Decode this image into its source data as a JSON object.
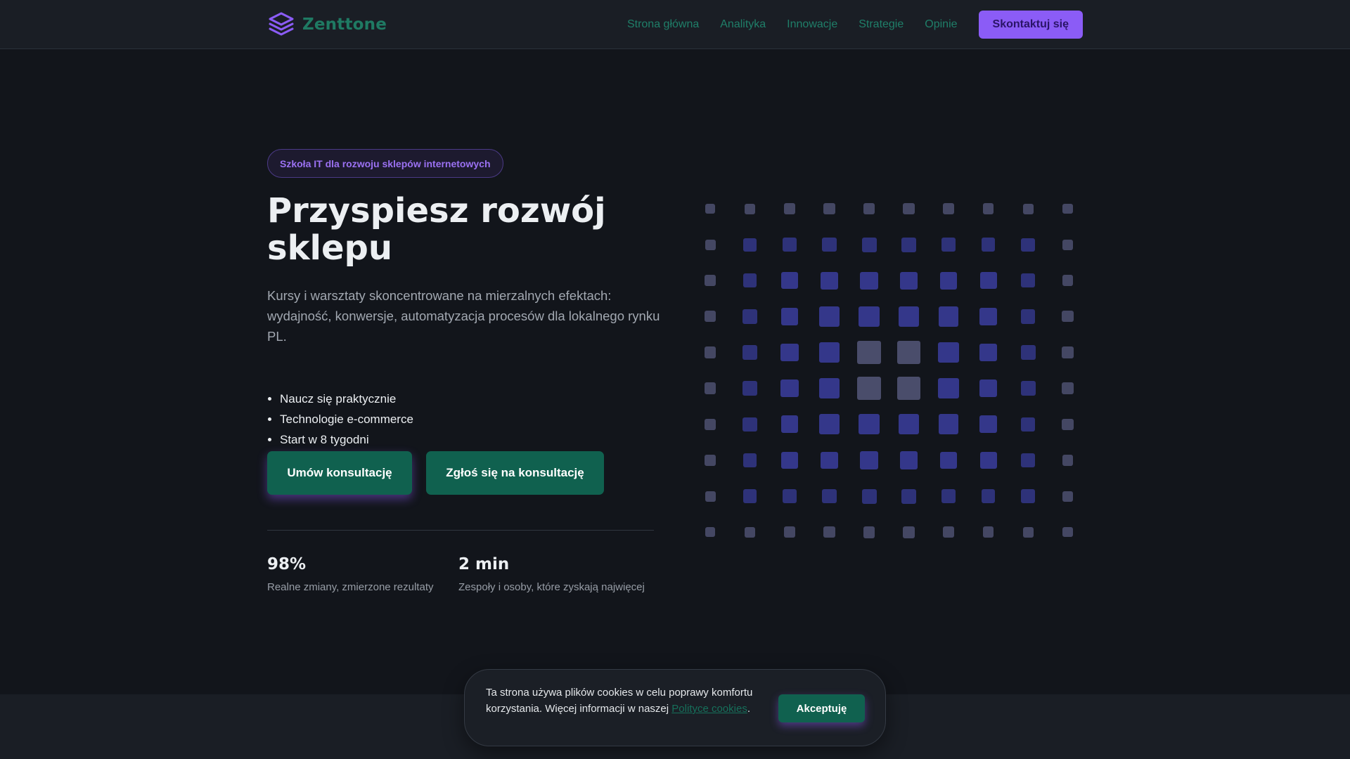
{
  "header": {
    "brand": "Zenttone",
    "nav": [
      "Strona główna",
      "Analityka",
      "Innowacje",
      "Strategie",
      "Opinie"
    ],
    "cta": "Skontaktuj się"
  },
  "hero": {
    "badge": "Szkoła IT dla rozwoju sklepów internetowych",
    "title": "Przyspiesz rozwój sklepu",
    "subtitle": "Kursy i warsztaty skoncentrowane na mierzalnych efektach: wydajność, konwersje, automatyzacja procesów dla lokalnego rynku PL.",
    "features": [
      "Naucz się praktycznie",
      "Technologie e-commerce",
      "Start w 8 tygodni"
    ],
    "primary_button": "Umów konsultację",
    "secondary_button": "Zgłoś się na konsultację"
  },
  "stats": [
    {
      "value": "98%",
      "label": "Realne zmiany, zmierzone rezultaty"
    },
    {
      "value": "2 min",
      "label": "Zespoły i osoby, które zyskają najwięcej"
    }
  ],
  "cookie": {
    "text": "Ta strona używa plików cookies w celu poprawy komfortu korzystania. Więcej informacji w naszej ",
    "link": "Polityce cookies",
    "suffix": ".",
    "button": "Akceptuję"
  },
  "colors": {
    "accent_purple": "#8b5cf6",
    "accent_green": "#10614f",
    "background": "#12151b",
    "grid_blue": "#34378a",
    "grid_gray": "#4a4d6b"
  }
}
